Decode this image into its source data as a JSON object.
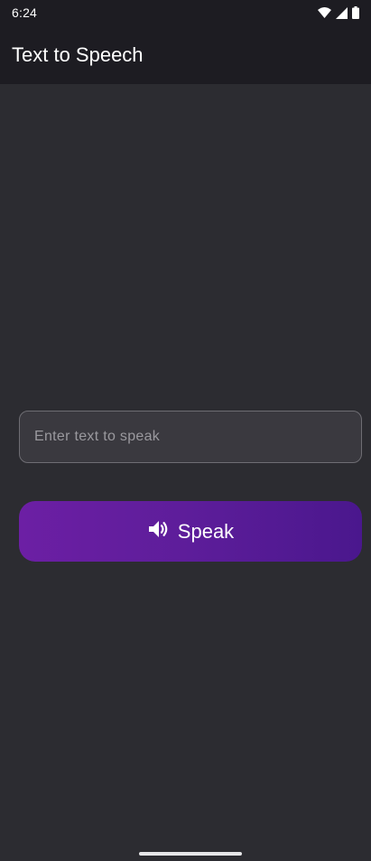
{
  "status_bar": {
    "time": "6:24",
    "icons": [
      "wifi-icon",
      "cell-signal-icon",
      "battery-icon"
    ]
  },
  "app_bar": {
    "title": "Text to Speech"
  },
  "input": {
    "value": "",
    "placeholder": "Enter text to speak"
  },
  "speak_button": {
    "label": "Speak",
    "icon": "volume-icon"
  },
  "colors": {
    "background": "#2c2c31",
    "app_bar": "#1d1c22",
    "field_background": "#3a393f",
    "button_gradient_start": "#6c1fa4",
    "button_gradient_end": "#4a178d"
  }
}
